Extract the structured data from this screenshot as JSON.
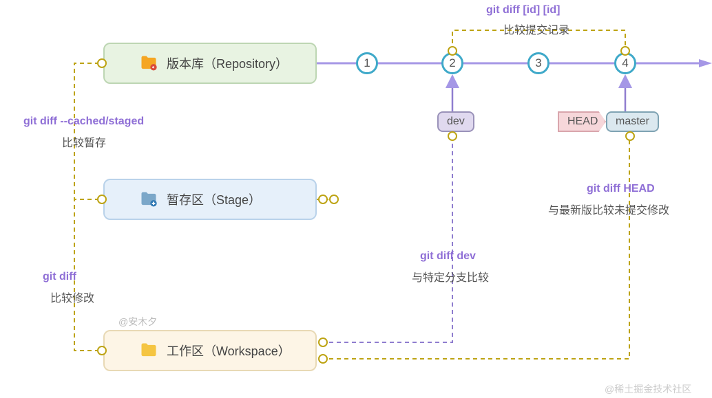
{
  "boxes": {
    "repo": {
      "label": "版本库（Repository）"
    },
    "stage": {
      "label": "暂存区（Stage）"
    },
    "ws": {
      "label": "工作区（Workspace）"
    }
  },
  "commits": {
    "n1": "1",
    "n2": "2",
    "n3": "3",
    "n4": "4"
  },
  "tags": {
    "dev": "dev",
    "head": "HEAD",
    "master": "master"
  },
  "diffs": {
    "id_id": {
      "cmd": "git diff [id] [id]",
      "desc": "比较提交记录"
    },
    "cached": {
      "cmd": "git diff --cached/staged",
      "desc": "比较暂存"
    },
    "plain": {
      "cmd": "git diff",
      "desc": "比较修改"
    },
    "dev": {
      "cmd": "git diff dev",
      "desc": "与特定分支比较"
    },
    "head": {
      "cmd": "git diff HEAD",
      "desc": "与最新版比较未提交修改"
    }
  },
  "watermarks": {
    "author": "@安木夕",
    "site": "@稀土掘金技术社区"
  },
  "chart_data": {
    "type": "diagram",
    "title": "git diff commands across Git areas",
    "areas": [
      {
        "id": "repo",
        "label": "版本库（Repository）"
      },
      {
        "id": "stage",
        "label": "暂存区（Stage）"
      },
      {
        "id": "ws",
        "label": "工作区（Workspace）"
      }
    ],
    "commits": [
      "1",
      "2",
      "3",
      "4"
    ],
    "refs": [
      {
        "name": "dev",
        "points_to": "2"
      },
      {
        "name": "HEAD",
        "points_to": "master"
      },
      {
        "name": "master",
        "points_to": "4"
      }
    ],
    "edges": [
      {
        "cmd": "git diff [id] [id]",
        "desc": "比较提交记录",
        "from": "commit-2",
        "to": "commit-4"
      },
      {
        "cmd": "git diff --cached/staged",
        "desc": "比较暂存",
        "from": "stage",
        "to": "repo"
      },
      {
        "cmd": "git diff",
        "desc": "比较修改",
        "from": "ws",
        "to": "stage"
      },
      {
        "cmd": "git diff dev",
        "desc": "与特定分支比较",
        "from": "ws",
        "to": "dev"
      },
      {
        "cmd": "git diff HEAD",
        "desc": "与最新版比较未提交修改",
        "from": "ws",
        "to": "HEAD"
      }
    ]
  }
}
